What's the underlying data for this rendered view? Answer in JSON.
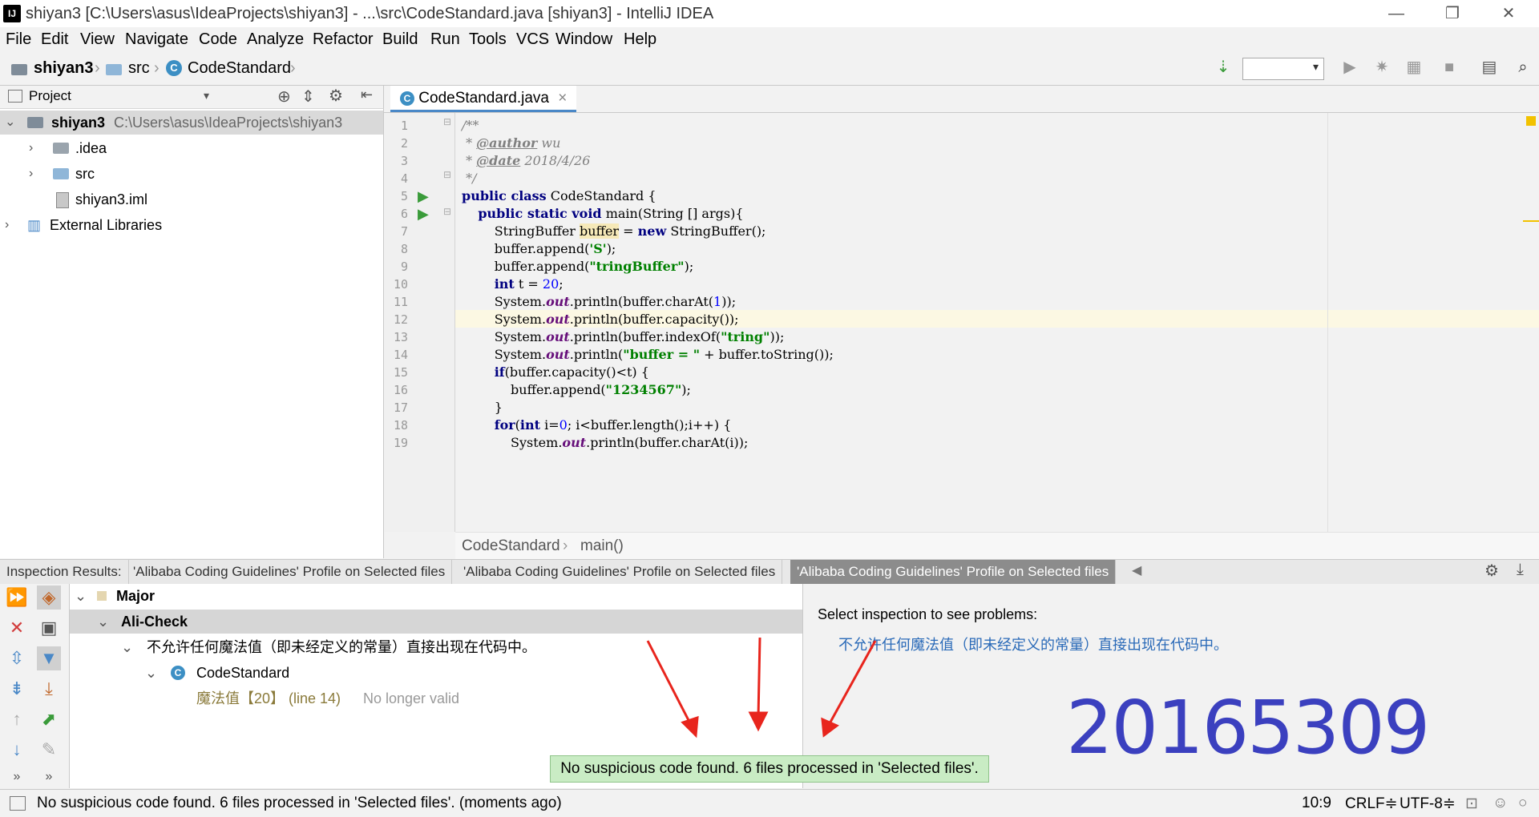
{
  "window": {
    "title": "shiyan3 [C:\\Users\\asus\\IdeaProjects\\shiyan3] - ...\\src\\CodeStandard.java [shiyan3] - IntelliJ IDEA",
    "logo": "IJ",
    "minimize": "—",
    "restore": "❐",
    "close": "✕"
  },
  "menu": [
    "File",
    "Edit",
    "View",
    "Navigate",
    "Code",
    "Analyze",
    "Refactor",
    "Build",
    "Run",
    "Tools",
    "VCS",
    "Window",
    "Help"
  ],
  "navbar": {
    "crumbs": [
      "shiyan3",
      "src",
      "CodeStandard"
    ],
    "class_icon_letter": "C"
  },
  "project_panel": {
    "title": "Project",
    "tree": [
      {
        "label": "shiyan3",
        "path": "C:\\Users\\asus\\IdeaProjects\\shiyan3"
      },
      {
        "label": ".idea"
      },
      {
        "label": "src"
      },
      {
        "label": "shiyan3.iml"
      },
      {
        "label": "External Libraries"
      }
    ]
  },
  "editor": {
    "tab_label": "CodeStandard.java",
    "tab_close": "×",
    "line_numbers": [
      "1",
      "2",
      "3",
      "4",
      "5",
      "6",
      "7",
      "8",
      "9",
      "10",
      "11",
      "12",
      "13",
      "14",
      "15",
      "16",
      "17",
      "18",
      "19"
    ],
    "breadcrumb": [
      "CodeStandard",
      "main()"
    ]
  },
  "inspection": {
    "label": "Inspection Results:",
    "tabs": [
      "'Alibaba Coding Guidelines' Profile on Selected files",
      "'Alibaba Coding Guidelines' Profile on Selected files",
      "'Alibaba Coding Guidelines' Profile on Selected files"
    ],
    "tree": {
      "severity": "Major",
      "group": "Ali-Check",
      "rule": "不允许任何魔法值（即未经定义的常量）直接出现在代码中。",
      "file": "CodeStandard",
      "problem": "魔法值【20】 (line 14)",
      "problem_state": "No longer valid"
    },
    "right_panel": {
      "heading": "Select inspection to see problems:",
      "link": "不允许任何魔法值（即未经定义的常量）直接出现在代码中。"
    }
  },
  "tooltip": "No suspicious code found. 6 files processed in 'Selected files'.",
  "handwritten_stamp": "20165309",
  "status": {
    "message": "No suspicious code found. 6 files processed in 'Selected files'. (moments ago)",
    "position": "10:9",
    "line_sep": "CRLF≑",
    "encoding": "UTF-8≑"
  },
  "colors": {
    "accent": "#4a88c7",
    "string": "#008000",
    "keyword": "#000080",
    "tooltip_bg": "#c9ecc4",
    "stamp": "#3b40bf",
    "annotation_arrow": "#e8251d"
  }
}
